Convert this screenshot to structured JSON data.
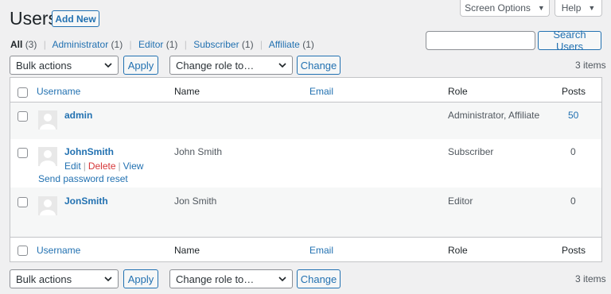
{
  "page": {
    "title": "Users",
    "add_new": "Add New"
  },
  "screen_options": {
    "label": "Screen Options"
  },
  "help": {
    "label": "Help"
  },
  "filters": [
    {
      "label": "All",
      "count": "(3)"
    },
    {
      "label": "Administrator",
      "count": "(1)"
    },
    {
      "label": "Editor",
      "count": "(1)"
    },
    {
      "label": "Subscriber",
      "count": "(1)"
    },
    {
      "label": "Affiliate",
      "count": "(1)"
    }
  ],
  "search": {
    "placeholder": "",
    "button": "Search Users"
  },
  "top_nav": {
    "bulk": "Bulk actions",
    "apply": "Apply",
    "role": "Change role to…",
    "change": "Change",
    "count": "3 items"
  },
  "bottom_nav": {
    "bulk": "Bulk actions",
    "apply": "Apply",
    "role": "Change role to…",
    "change": "Change",
    "count": "3 items"
  },
  "columns": {
    "username": "Username",
    "name": "Name",
    "email": "Email",
    "role": "Role",
    "posts": "Posts"
  },
  "rows": [
    {
      "username": "admin",
      "name": "",
      "email": "",
      "role": "Administrator, Affiliate",
      "posts": "50"
    },
    {
      "username": "JohnSmith",
      "name": "John Smith",
      "email": "",
      "role": "Subscriber",
      "posts": "0",
      "actions": {
        "edit": "Edit",
        "delete": "Delete",
        "view": "View",
        "reset": "Send password reset"
      }
    },
    {
      "username": "JonSmith",
      "name": "Jon Smith",
      "email": "",
      "role": "Editor",
      "posts": "0"
    }
  ],
  "colors": {
    "link": "#2271b1",
    "delete": "#d63638",
    "background": "#f0f0f1"
  }
}
